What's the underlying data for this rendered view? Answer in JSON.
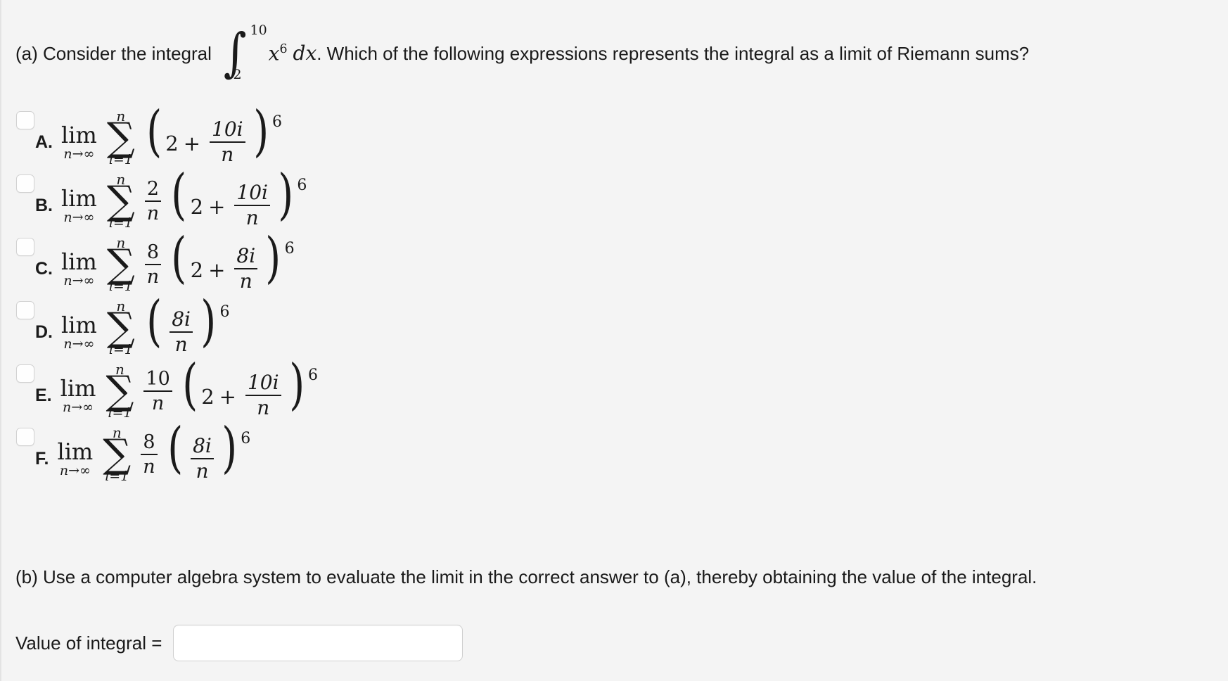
{
  "background_color": "#f4f4f4",
  "part_a": {
    "prefix": "(a) Consider the integral",
    "integral": {
      "sign": "∫",
      "lower_limit": "2",
      "upper_limit": "10",
      "integrand_base": "x",
      "integrand_exponent": "6",
      "differential": "dx"
    },
    "suffix": ". Which of the following expressions represents the integral as a limit of Riemann sums?"
  },
  "options": [
    {
      "letter": "A.",
      "checked": false,
      "lim_op": "lim",
      "lim_sub": "n→∞",
      "sum_top": "n",
      "sum_sign": "∑",
      "sum_bottom": "i=1",
      "coefficient": null,
      "paren_open": "(",
      "paren_close": ")",
      "term1": "2",
      "operator": "+",
      "inner_num": "10i",
      "inner_den": "n",
      "exponent": "6",
      "plain": "lim n→∞ ∑(i=1..n) (2 + 10i/n)^6"
    },
    {
      "letter": "B.",
      "checked": false,
      "lim_op": "lim",
      "lim_sub": "n→∞",
      "sum_top": "n",
      "sum_sign": "∑",
      "sum_bottom": "i=1",
      "coefficient": {
        "num": "2",
        "den": "n"
      },
      "paren_open": "(",
      "paren_close": ")",
      "term1": "2",
      "operator": "+",
      "inner_num": "10i",
      "inner_den": "n",
      "exponent": "6",
      "plain": "lim n→∞ ∑(i=1..n) (2/n)(2 + 10i/n)^6"
    },
    {
      "letter": "C.",
      "checked": false,
      "lim_op": "lim",
      "lim_sub": "n→∞",
      "sum_top": "n",
      "sum_sign": "∑",
      "sum_bottom": "i=1",
      "coefficient": {
        "num": "8",
        "den": "n"
      },
      "paren_open": "(",
      "paren_close": ")",
      "term1": "2",
      "operator": "+",
      "inner_num": "8i",
      "inner_den": "n",
      "exponent": "6",
      "plain": "lim n→∞ ∑(i=1..n) (8/n)(2 + 8i/n)^6"
    },
    {
      "letter": "D.",
      "checked": false,
      "lim_op": "lim",
      "lim_sub": "n→∞",
      "sum_top": "n",
      "sum_sign": "∑",
      "sum_bottom": "i=1",
      "coefficient": null,
      "paren_open": "(",
      "paren_close": ")",
      "term1": null,
      "operator": null,
      "inner_num": "8i",
      "inner_den": "n",
      "exponent": "6",
      "plain": "lim n→∞ ∑(i=1..n) (8i/n)^6"
    },
    {
      "letter": "E.",
      "checked": false,
      "lim_op": "lim",
      "lim_sub": "n→∞",
      "sum_top": "n",
      "sum_sign": "∑",
      "sum_bottom": "i=1",
      "coefficient": {
        "num": "10",
        "den": "n"
      },
      "paren_open": "(",
      "paren_close": ")",
      "term1": "2",
      "operator": "+",
      "inner_num": "10i",
      "inner_den": "n",
      "exponent": "6",
      "plain": "lim n→∞ ∑(i=1..n) (10/n)(2 + 10i/n)^6"
    },
    {
      "letter": "F.",
      "checked": false,
      "lim_op": "lim",
      "lim_sub": "n→∞",
      "sum_top": "n",
      "sum_sign": "∑",
      "sum_bottom": "i=1",
      "coefficient": {
        "num": "8",
        "den": "n"
      },
      "paren_open": "(",
      "paren_close": ")",
      "term1": null,
      "operator": null,
      "inner_num": "8i",
      "inner_den": "n",
      "exponent": "6",
      "plain": "lim n→∞ ∑(i=1..n) (8/n)(8i/n)^6"
    }
  ],
  "part_b": {
    "text": "(b) Use a computer algebra system to evaluate the limit in the correct answer to (a), thereby obtaining the value of the integral."
  },
  "answer": {
    "label": "Value of integral =",
    "value": "",
    "placeholder": ""
  }
}
